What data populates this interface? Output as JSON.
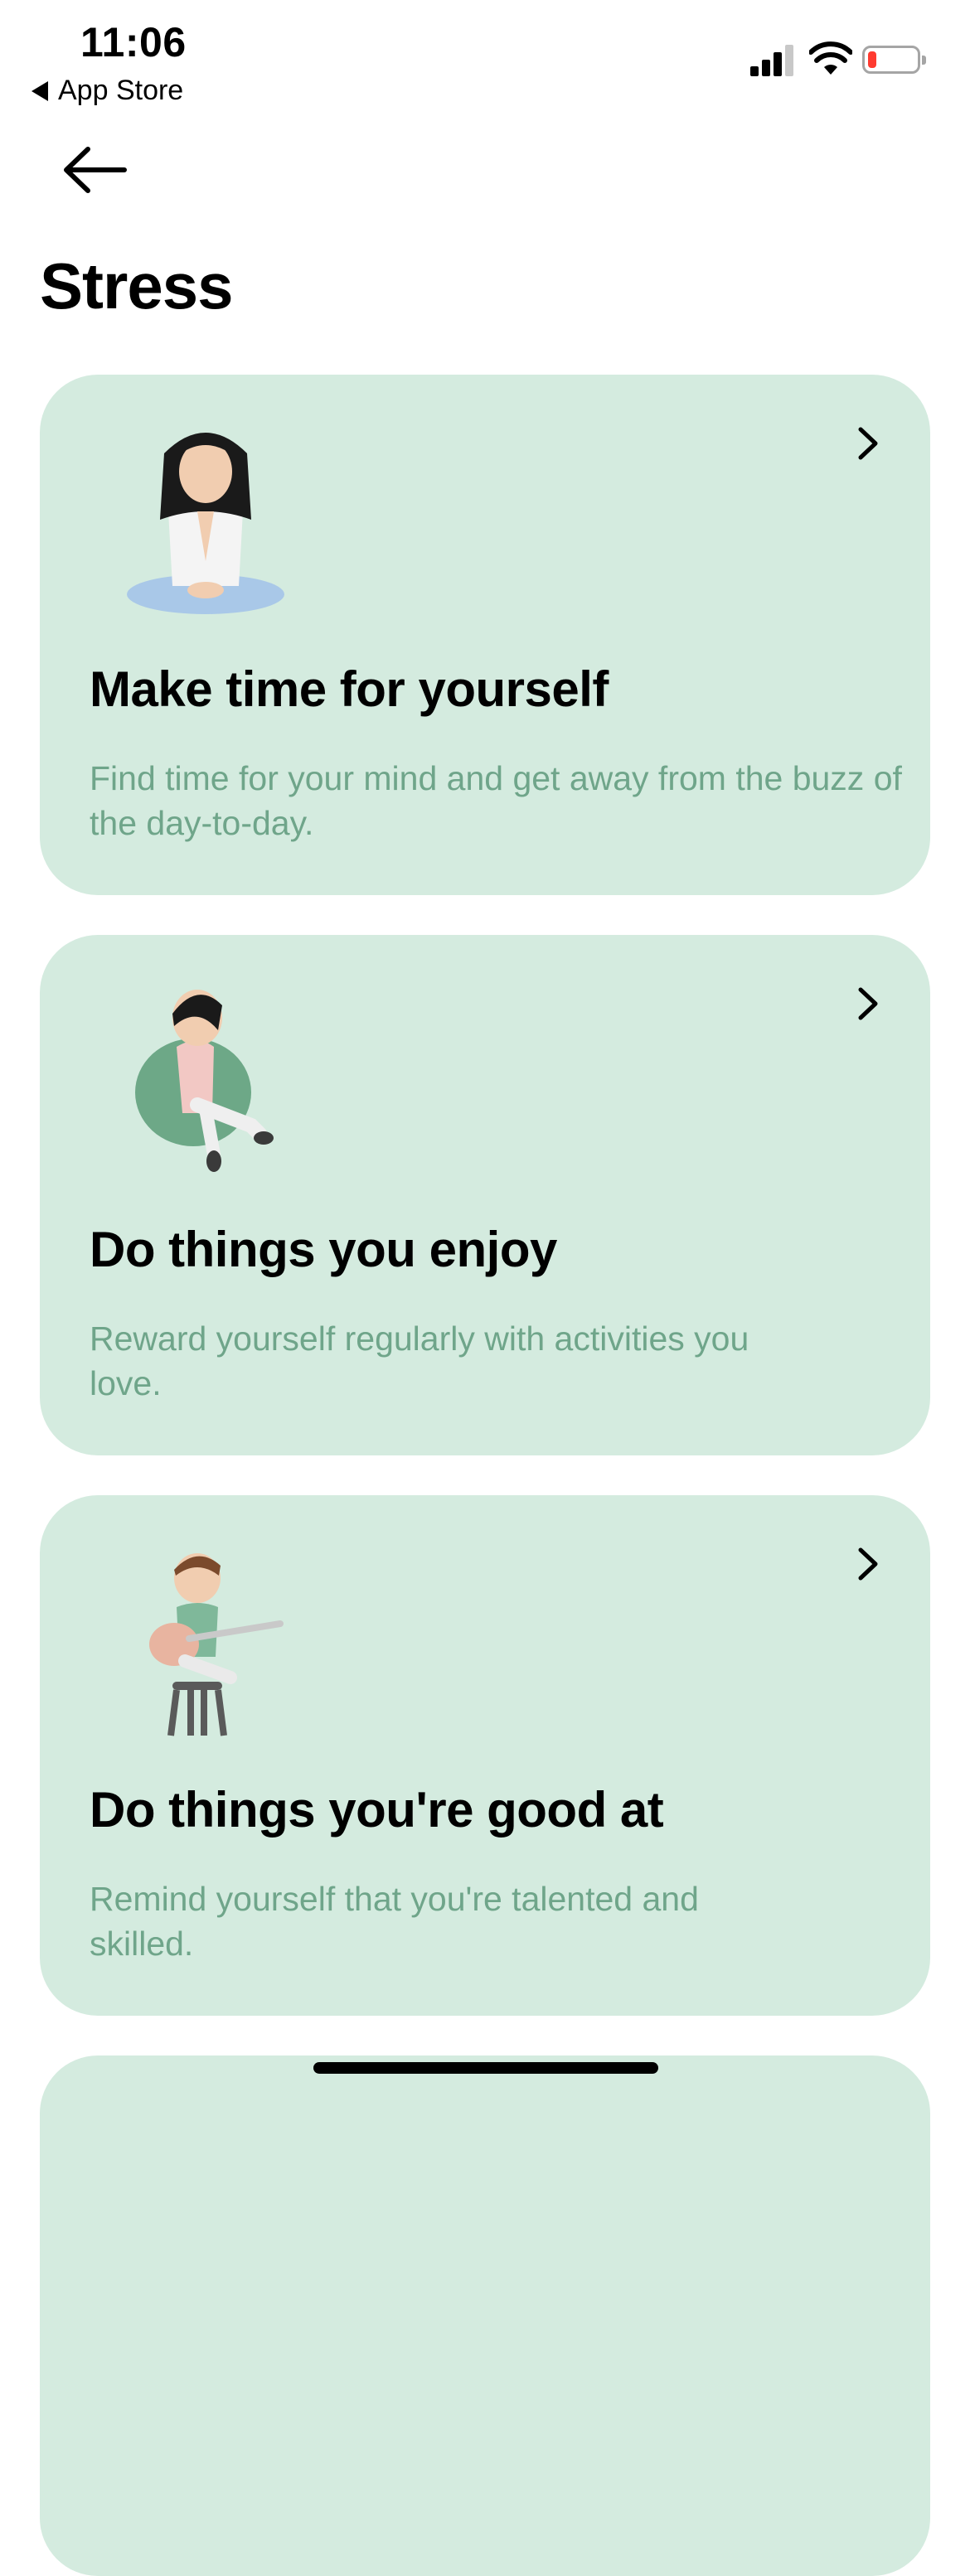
{
  "status_bar": {
    "time": "11:06",
    "back_app_label": "App Store",
    "battery_color": "#ff3b30"
  },
  "nav": {
    "back_icon": "arrow-left-icon"
  },
  "page": {
    "title": "Stress"
  },
  "cards": [
    {
      "title": "Make time for yourself",
      "description": "Find time for your mind and get away from the buzz of the day-to-day.",
      "illustration": "meditating-woman-illustration"
    },
    {
      "title": "Do things you enjoy",
      "description": "Reward yourself regularly with activities you love.",
      "illustration": "reading-woman-beanbag-illustration"
    },
    {
      "title": "Do things you're good at",
      "description": "Remind yourself that you're talented and skilled.",
      "illustration": "guitar-man-stool-illustration"
    }
  ],
  "colors": {
    "card_bg": "#d4ebdf",
    "desc_text": "#6fa58a"
  }
}
